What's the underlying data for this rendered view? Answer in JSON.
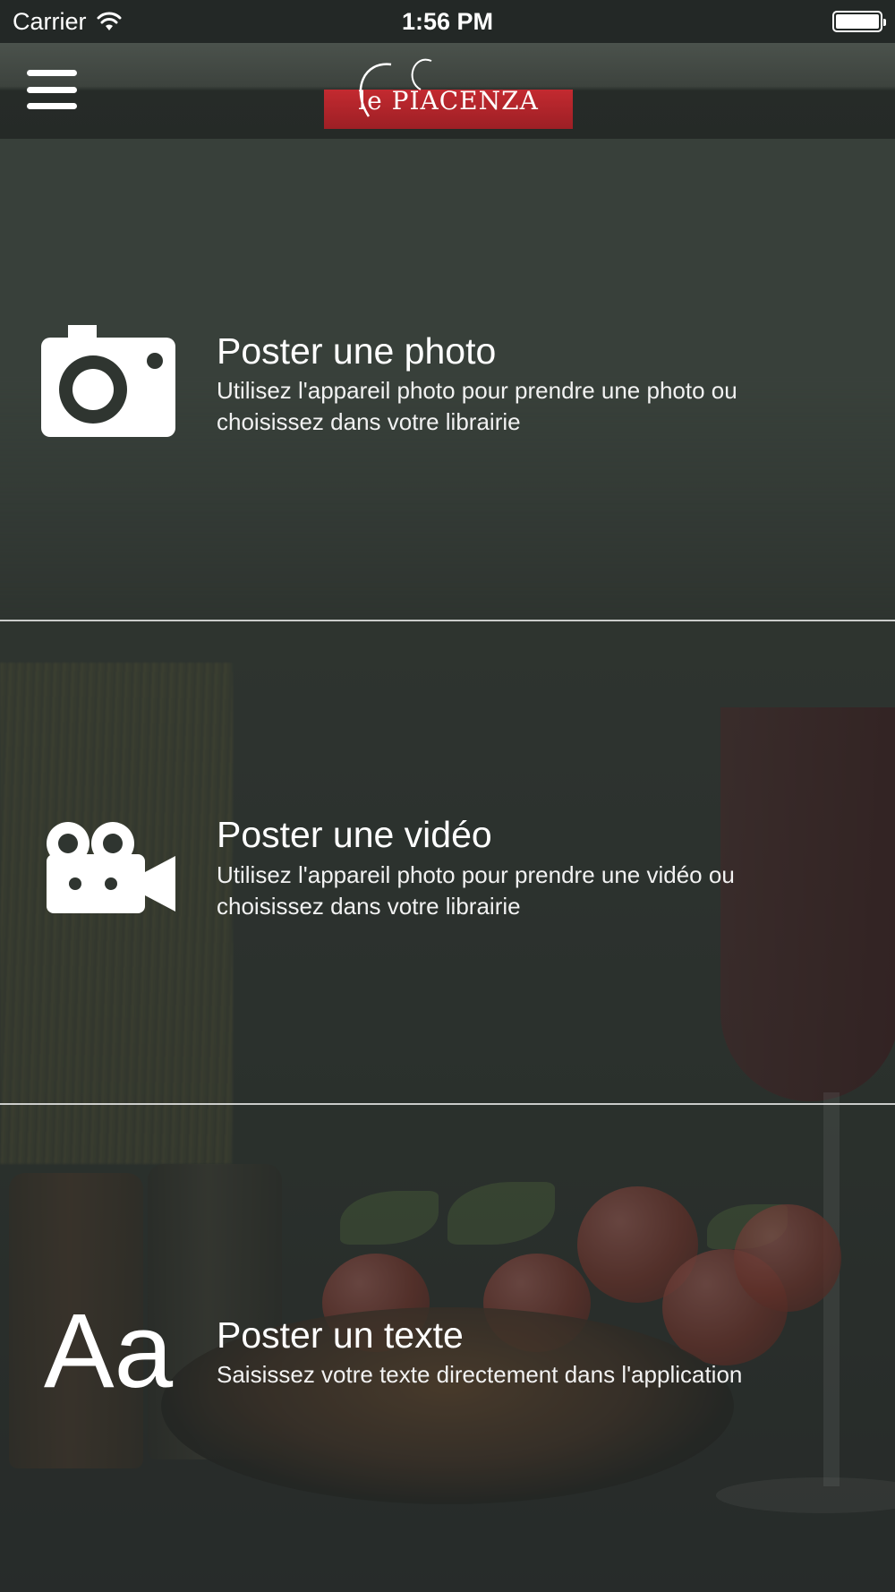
{
  "status_bar": {
    "carrier": "Carrier",
    "time": "1:56 PM"
  },
  "header": {
    "logo_text": "le PIACENZA"
  },
  "rows": [
    {
      "title": "Poster une photo",
      "description": "Utilisez l'appareil photo pour prendre une photo ou choisissez dans votre librairie",
      "icon": "camera-icon"
    },
    {
      "title": "Poster une vidéo",
      "description": "Utilisez l'appareil photo pour prendre une vidéo ou choisissez dans votre librairie",
      "icon": "video-camera-icon"
    },
    {
      "title": "Poster un texte",
      "description": "Saisissez votre texte directement dans l'application",
      "icon": "text-icon",
      "icon_glyph": "Aa"
    }
  ],
  "colors": {
    "background": "#2f3530",
    "logo_red": "#c32a30",
    "text": "#ffffff"
  }
}
